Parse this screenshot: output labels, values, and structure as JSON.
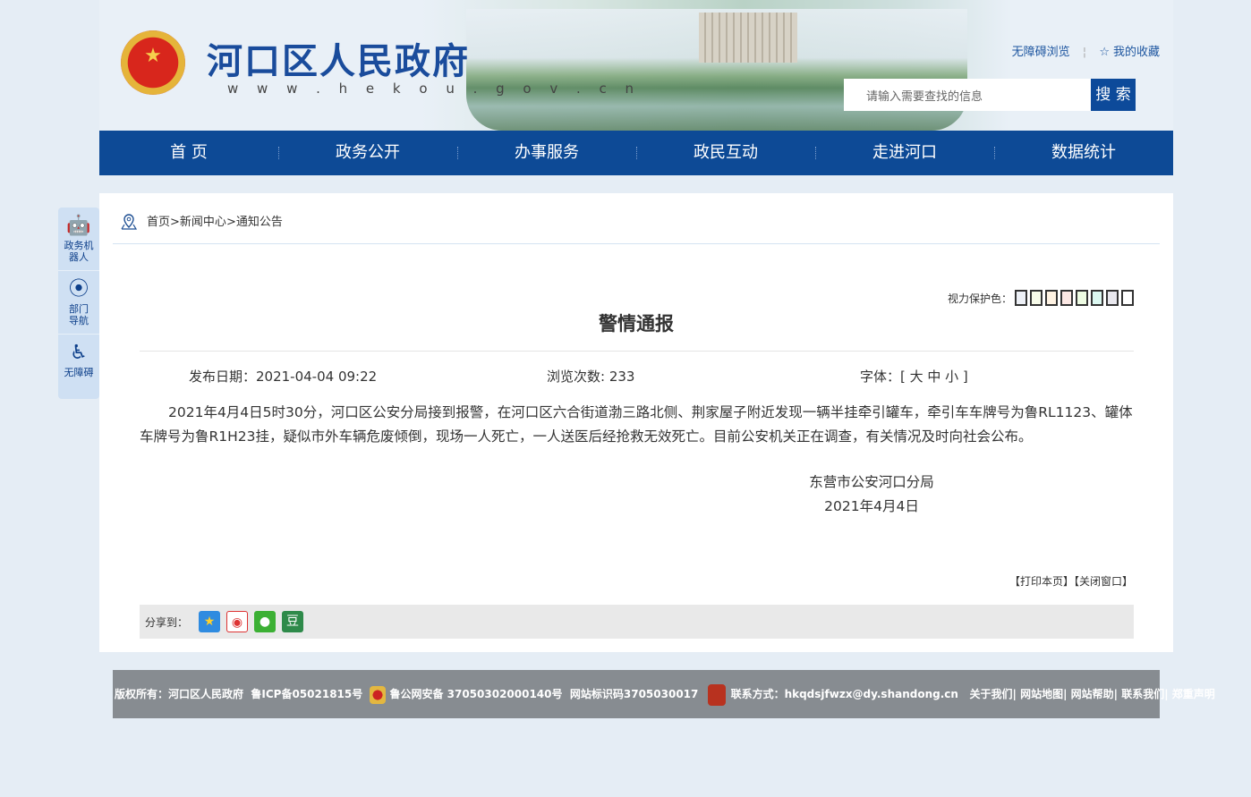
{
  "header": {
    "site_title": "河口区人民政府",
    "url": "w w w . h e k o u . g o v . c n",
    "accessible": "无障碍浏览",
    "favorites": "我的收藏",
    "search_placeholder": "请输入需要查找的信息",
    "search_btn": "搜 索"
  },
  "nav": [
    "首 页",
    "政务公开",
    "办事服务",
    "政民互动",
    "走进河口",
    "数据统计"
  ],
  "side": [
    {
      "label": "政务机器人"
    },
    {
      "label": "部门导航"
    },
    {
      "label": "无障碍"
    }
  ],
  "crumb": [
    "首页",
    ">",
    "新闻中心",
    ">",
    "通知公告"
  ],
  "eye_label": "视力保护色：",
  "eye_colors": [
    "#edf0f6",
    "#f7fbe9",
    "#fff3e3",
    "#fce8e4",
    "#eefce3",
    "#dcf8f1",
    "#e9e8ee",
    "#ffffff"
  ],
  "article": {
    "title": "警情通报",
    "date": "发布日期：2021-04-04 09:22",
    "views": "浏览次数: 233",
    "font": "字体：[ 大 中 小 ]",
    "body": "2021年4月4日5时30分，河口区公安分局接到报警，在河口区六合街道渤三路北侧、荆家屋子附近发现一辆半挂牵引罐车，牵引车车牌号为鲁RL1123、罐体车牌号为鲁R1H23挂，疑似市外车辆危废倾倒，现场一人死亡，一人送医后经抢救无效死亡。目前公安机关正在调查，有关情况及时向社会公布。",
    "sign_org": "东营市公安河口分局",
    "sign_date": "2021年4月4日"
  },
  "print": "【打印本页】",
  "close": "【关闭窗口】",
  "share_label": "分享到：",
  "footer": {
    "copyright": "版权所有：河口区人民政府",
    "icp": "鲁ICP备05021815号",
    "police": "鲁公网安备 37050302000140号",
    "site_id": "网站标识码3705030017",
    "contact": "联系方式：hkqdsjfwzx@dy.shandong.cn",
    "links": [
      "关于我们",
      "网站地图",
      "网站帮助",
      "联系我们",
      "郑重声明"
    ]
  }
}
